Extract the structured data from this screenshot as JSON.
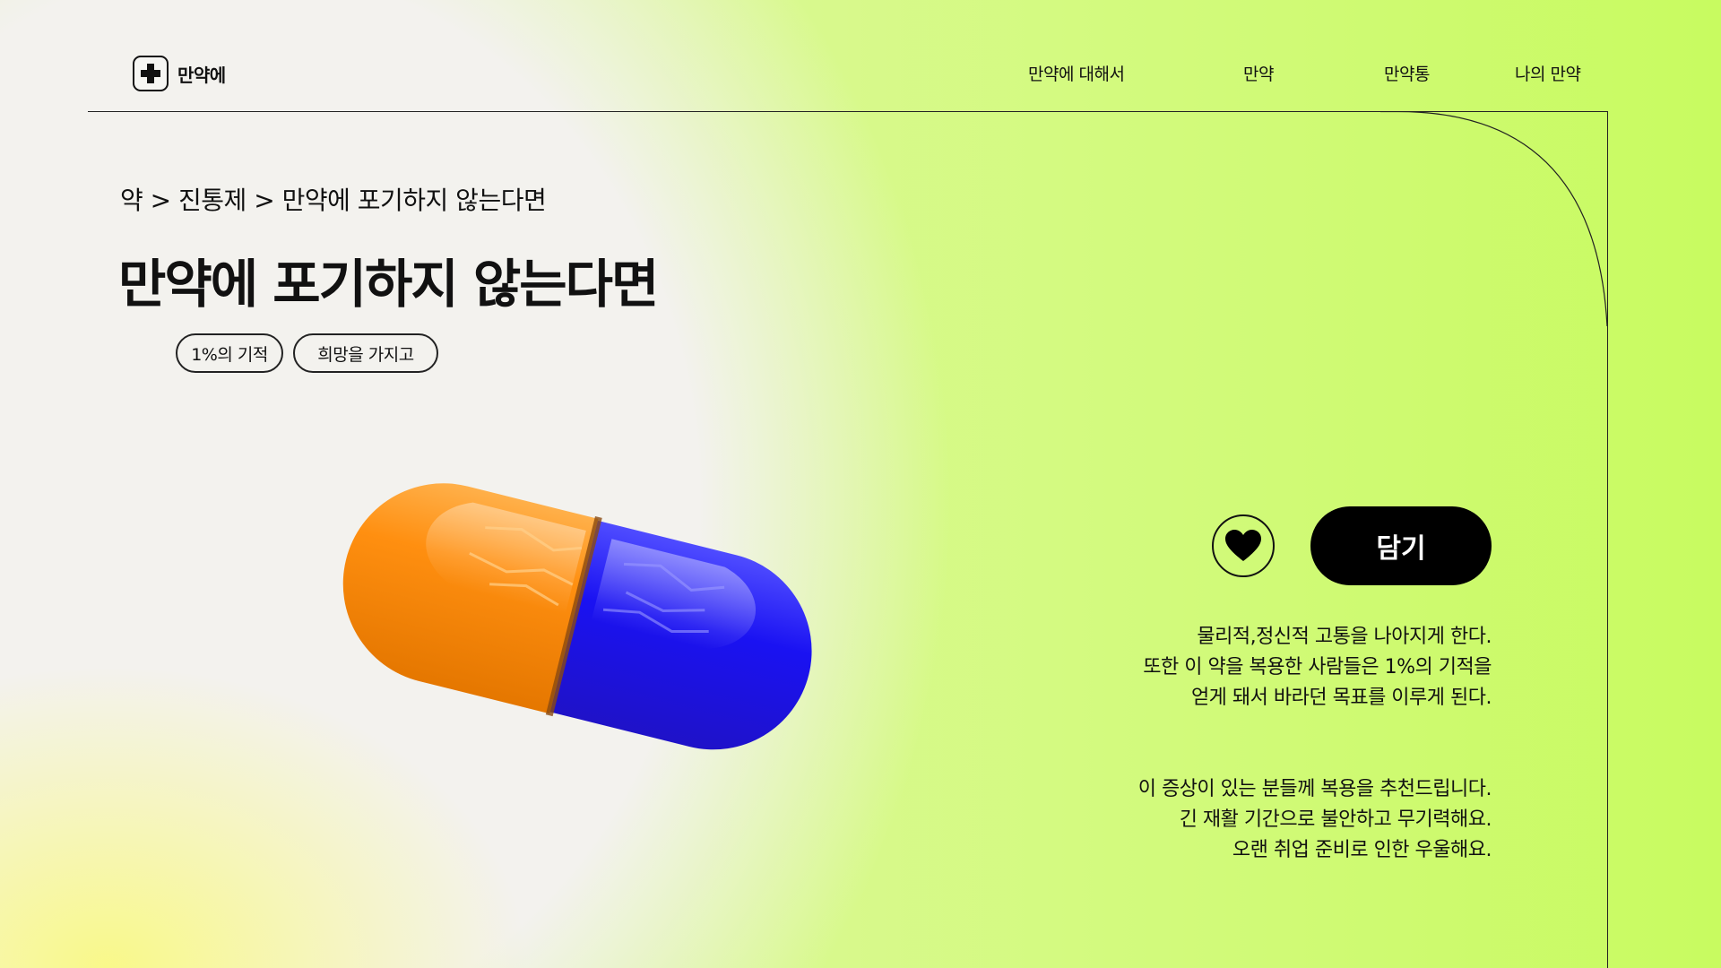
{
  "brand": {
    "name": "만약에",
    "icon": "plus-icon"
  },
  "nav": {
    "items": [
      "만약에 대해서",
      "만약",
      "만약통",
      "나의 만약"
    ]
  },
  "breadcrumb": "약 > 진통제 > 만약에 포기하지 않는다면",
  "product": {
    "title": "만약에 포기하지 않는다면",
    "tags": [
      "1%의 기적",
      "희망을 가지고"
    ],
    "image": "capsule-pill",
    "favorite_icon": "heart-icon",
    "cart_label": "담기"
  },
  "description": {
    "effects": [
      "물리적,정신적 고통을 나아지게 한다.",
      "또한 이 약을 복용한 사람들은 1%의 기적을",
      "얻게 돼서 바라던 목표를 이루게 된다."
    ],
    "recommend": [
      "이 증상이 있는 분들께 복용을 추천드립니다.",
      "긴 재활 기간으로 불안하고 무기력해요.",
      "오랜 취업 준비로 인한 우울해요."
    ]
  },
  "colors": {
    "accent_green": "#c8fb60",
    "pill_orange": "#ff8a00",
    "pill_blue": "#1f10f0",
    "button": "#000000"
  }
}
